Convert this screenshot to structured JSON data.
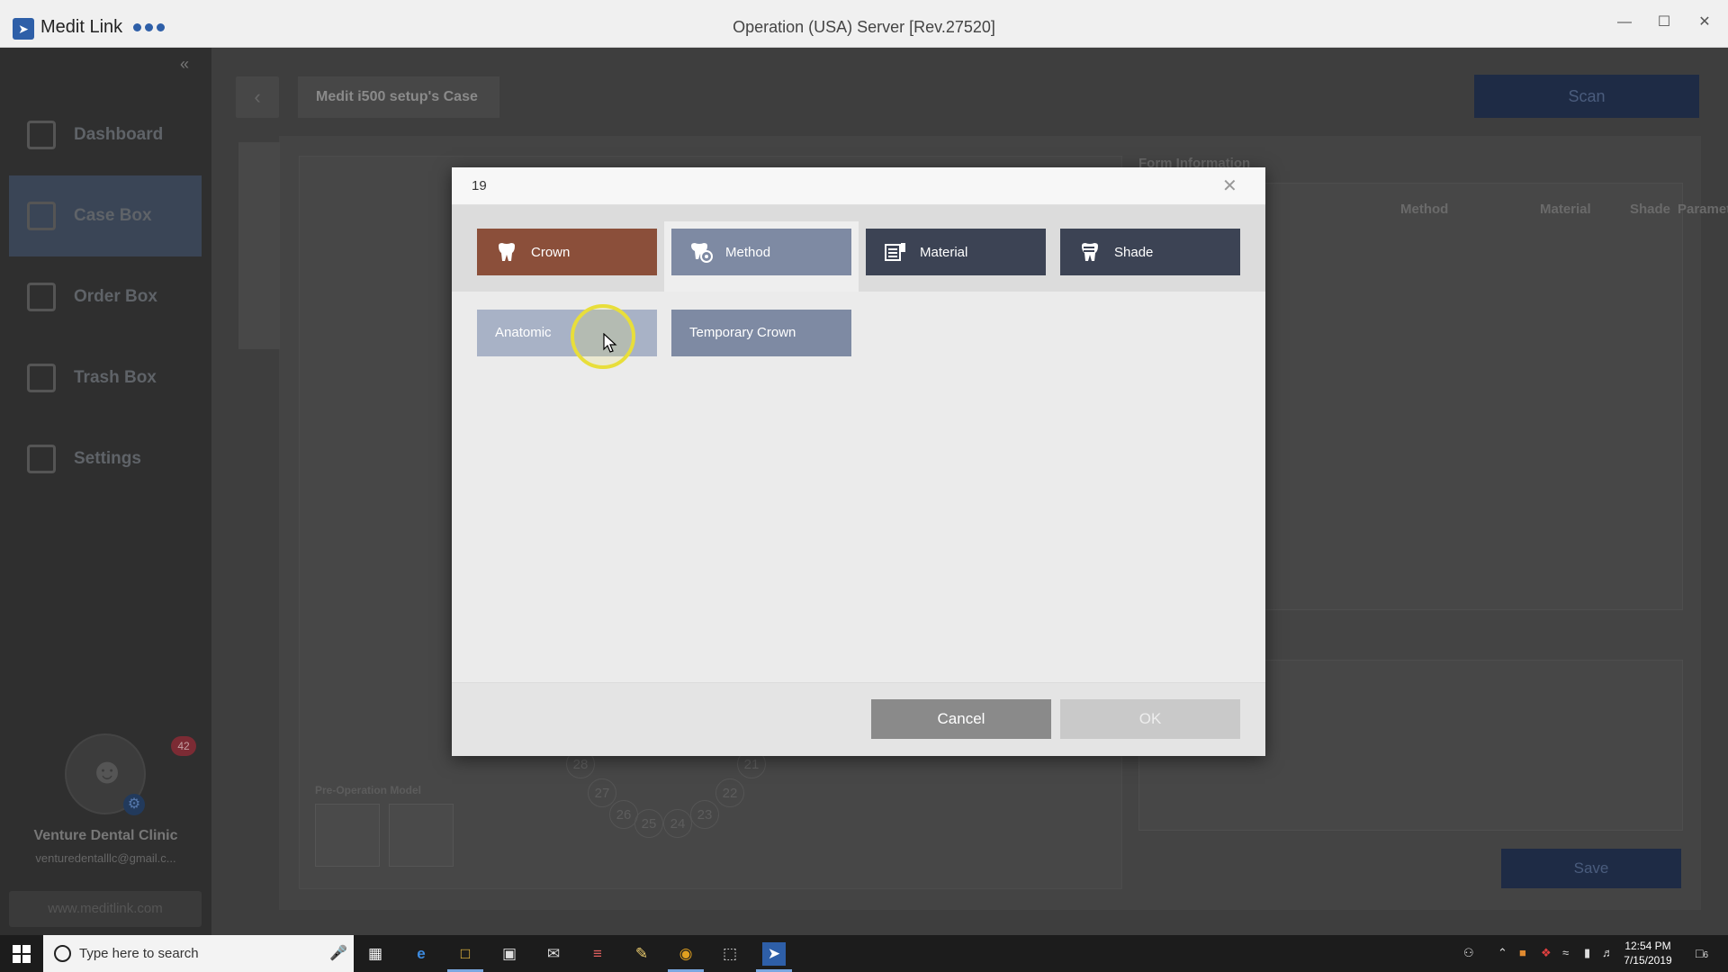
{
  "titlebar": {
    "app_name": "Medit Link",
    "window_title": "Operation (USA) Server [Rev.27520]"
  },
  "sidebar": {
    "items": [
      {
        "label": "Dashboard"
      },
      {
        "label": "Case Box"
      },
      {
        "label": "Order Box"
      },
      {
        "label": "Trash Box"
      },
      {
        "label": "Settings"
      }
    ],
    "notification_count": "42",
    "clinic_name": "Venture Dental Clinic",
    "clinic_email": "venturedentalllc@gmail.c...",
    "website": "www.meditlink.com"
  },
  "main": {
    "case_title": "Medit i500 setup's Case",
    "scan_label": "Scan",
    "form_info_label": "Form Information",
    "columns": [
      "Method",
      "Material",
      "Shade",
      "Parameter"
    ],
    "save_label": "Save",
    "pre_op_label": "Pre-Operation Model",
    "teeth": [
      "28",
      "27",
      "26",
      "25",
      "24",
      "23",
      "22",
      "21"
    ]
  },
  "modal": {
    "title": "19",
    "tabs": [
      {
        "label": "Crown",
        "color": "#8b4f3a"
      },
      {
        "label": "Method",
        "color": "#7e8aa3"
      },
      {
        "label": "Material",
        "color": "#3c4354"
      },
      {
        "label": "Shade",
        "color": "#3c4354"
      }
    ],
    "options": [
      {
        "label": "Anatomic"
      },
      {
        "label": "Temporary Crown"
      }
    ],
    "cancel_label": "Cancel",
    "ok_label": "OK"
  },
  "taskbar": {
    "search_placeholder": "Type here to search",
    "time": "12:54 PM",
    "date": "7/15/2019",
    "notification_count": "6"
  }
}
